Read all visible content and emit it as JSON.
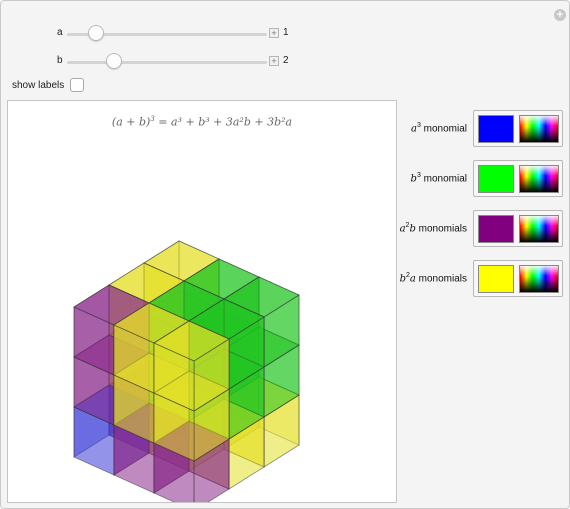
{
  "sliders": [
    {
      "label": "a",
      "value": "1",
      "fraction": 0.15
    },
    {
      "label": "b",
      "value": "2",
      "fraction": 0.24
    }
  ],
  "show_labels": {
    "label": "show labels",
    "checked": false
  },
  "equation": {
    "lhs": "(a + b)",
    "lhs_exp": "3",
    "rhs": "= a³ + b³ + 3a²b + 3b²a"
  },
  "legend": [
    {
      "base": "a",
      "exp": "3",
      "tail": "",
      "word": "monomial",
      "color": "#0000ff",
      "icon": "color-picker-icon"
    },
    {
      "base": "b",
      "exp": "3",
      "tail": "",
      "word": "monomial",
      "color": "#00ff00",
      "icon": "color-picker-icon"
    },
    {
      "base": "a",
      "exp": "2",
      "tail": "b",
      "word": "monomials",
      "color": "#800080",
      "icon": "color-picker-icon"
    },
    {
      "base": "b",
      "exp": "2",
      "tail": "a",
      "word": "monomials",
      "color": "#ffff00",
      "icon": "color-picker-icon"
    }
  ],
  "colors": {
    "a3": "#3a3ad8",
    "b3": "#22c422",
    "a2b": "#8a2a8a",
    "b2a": "#e4e028"
  },
  "corner_icon": "plus-circle-icon"
}
